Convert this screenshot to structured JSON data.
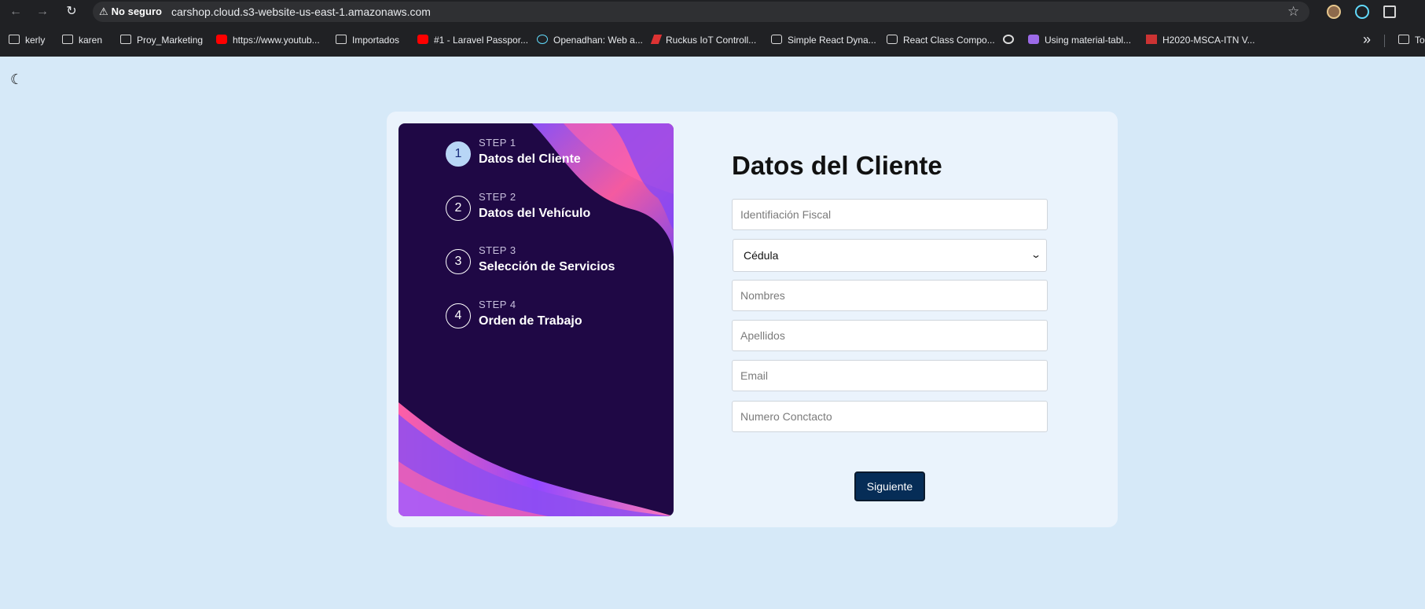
{
  "browser": {
    "security_label": "No seguro",
    "url": "carshop.cloud.s3-website-us-east-1.amazonaws.com",
    "icons": {
      "back": "←",
      "forward": "→",
      "reload": "↻",
      "warning": "⚠",
      "star": "☆",
      "more": "»",
      "theme": "☾"
    },
    "bookmarks": [
      {
        "label": "kerly",
        "icon": "folder-icon"
      },
      {
        "label": "karen",
        "icon": "folder-icon"
      },
      {
        "label": "Proy_Marketing",
        "icon": "folder-icon"
      },
      {
        "label": "https://www.youtub...",
        "icon": "youtube-icon"
      },
      {
        "label": "Importados",
        "icon": "folder-icon"
      },
      {
        "label": "#1 - Laravel Passpor...",
        "icon": "youtube-icon"
      },
      {
        "label": "Openadhan: Web a...",
        "icon": "react-icon"
      },
      {
        "label": "Ruckus IoT Controll...",
        "icon": "ruckus-icon"
      },
      {
        "label": "Simple React Dyna...",
        "icon": "codesandbox-icon"
      },
      {
        "label": "React Class Compo...",
        "icon": "codesandbox-icon"
      },
      {
        "label": "",
        "icon": "globe-icon"
      },
      {
        "label": "Using material-tabl...",
        "icon": "material-ui-icon"
      },
      {
        "label": "H2020-MSCA-ITN V...",
        "icon": "h2020-icon"
      },
      {
        "label": "To",
        "icon": "folder-icon"
      }
    ]
  },
  "steps": [
    {
      "kicker": "STEP 1",
      "title": "Datos del Cliente",
      "number": "1",
      "active": true
    },
    {
      "kicker": "STEP 2",
      "title": "Datos del Vehículo",
      "number": "2",
      "active": false
    },
    {
      "kicker": "STEP 3",
      "title": "Selección de Servicios",
      "number": "3",
      "active": false
    },
    {
      "kicker": "STEP 4",
      "title": "Orden de Trabajo",
      "number": "4",
      "active": false
    }
  ],
  "form": {
    "title": "Datos del Cliente",
    "fiscal_id_placeholder": "Identifiación Fiscal",
    "document_type": "Cédula",
    "names_placeholder": "Nombres",
    "surnames_placeholder": "Apellidos",
    "email_placeholder": "Email",
    "contact_placeholder": "Numero Conctacto",
    "next_label": "Siguiente"
  },
  "colors": {
    "page_background": "#d6e9f8",
    "card_background": "#eaf3fc",
    "sidebar_background": "#1f0845",
    "accent_pink": "#f05ca3",
    "accent_purple": "#8d4df1",
    "button": "#062d57"
  }
}
